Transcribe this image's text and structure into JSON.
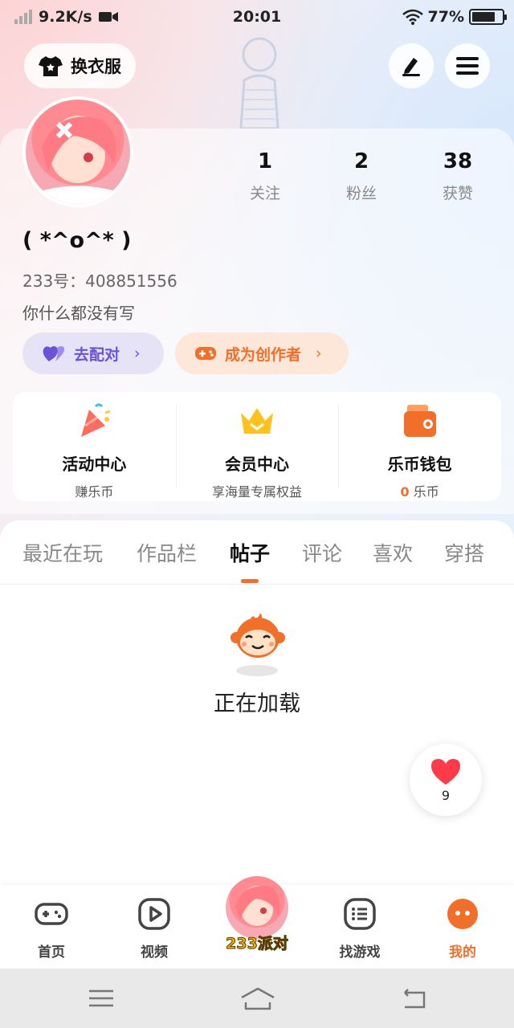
{
  "status_bar": {
    "speed": "9.2K/s",
    "time": "20:01",
    "battery": "77%",
    "battery_level": 0.77
  },
  "header": {
    "outfit_label": "换衣服",
    "outfit_icon": "tshirt-icon",
    "edit_icon": "pencil-icon",
    "menu_icon": "menu-icon"
  },
  "profile": {
    "nickname": "( *^o^* )",
    "uid": "233号：408851556",
    "bio": "你什么都没有写",
    "stats": [
      {
        "value": "1",
        "label": "关注"
      },
      {
        "value": "2",
        "label": "粉丝"
      },
      {
        "value": "38",
        "label": "获赞"
      }
    ],
    "match_label": "去配对",
    "creator_label": "成为创作者"
  },
  "quick_entries": [
    {
      "title": "活动中心",
      "subtitle": "赚乐币",
      "icon": "party-popper-icon"
    },
    {
      "title": "会员中心",
      "subtitle": "享海量专属权益",
      "icon": "crown-icon"
    },
    {
      "title": "乐币钱包",
      "coin_value": "0",
      "coin_unit": "乐币",
      "icon": "wallet-icon"
    }
  ],
  "tabs": [
    "最近在玩",
    "作品栏",
    "帖子",
    "评论",
    "喜欢",
    "穿搭"
  ],
  "active_tab": "帖子",
  "content": {
    "loading_text": "正在加载",
    "like_count": "9"
  },
  "bottom_nav": [
    {
      "label": "首页",
      "icon": "gamepad-icon"
    },
    {
      "label": "视频",
      "icon": "play-icon"
    },
    {
      "label": "233派对",
      "icon": "avatar-party-icon"
    },
    {
      "label": "找游戏",
      "icon": "list-icon"
    },
    {
      "label": "我的",
      "icon": "profile-face-icon"
    }
  ],
  "colors": {
    "accent": "#f26f2a",
    "match_purple": "#6b52d8"
  }
}
